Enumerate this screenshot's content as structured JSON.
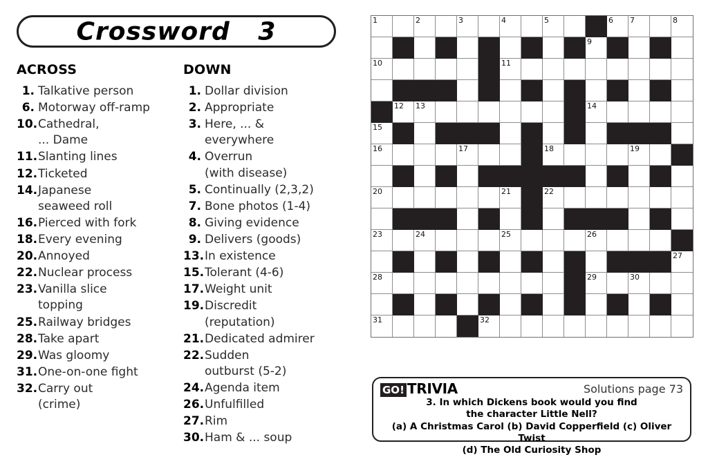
{
  "title": "Crossword   3",
  "across": {
    "heading": "ACROSS",
    "clues": [
      {
        "num": "1.",
        "text": "Talkative person"
      },
      {
        "num": "6.",
        "text": "Motorway off-ramp"
      },
      {
        "num": "10.",
        "text": "Cathedral,\n... Dame"
      },
      {
        "num": "11.",
        "text": "Slanting lines"
      },
      {
        "num": "12.",
        "text": "Ticketed"
      },
      {
        "num": "14.",
        "text": "Japanese\nseaweed roll"
      },
      {
        "num": "16.",
        "text": "Pierced with fork"
      },
      {
        "num": "18.",
        "text": "Every evening"
      },
      {
        "num": "20.",
        "text": "Annoyed"
      },
      {
        "num": "22.",
        "text": "Nuclear process"
      },
      {
        "num": "23.",
        "text": "Vanilla slice\ntopping"
      },
      {
        "num": "25.",
        "text": "Railway bridges"
      },
      {
        "num": "28.",
        "text": "Take apart"
      },
      {
        "num": "29.",
        "text": "Was gloomy"
      },
      {
        "num": "31.",
        "text": "One-on-one fight"
      },
      {
        "num": "32.",
        "text": "Carry out\n(crime)"
      }
    ]
  },
  "down": {
    "heading": "DOWN",
    "clues": [
      {
        "num": "1.",
        "text": "Dollar division"
      },
      {
        "num": "2.",
        "text": "Appropriate"
      },
      {
        "num": "3.",
        "text": "Here, ... &\neverywhere"
      },
      {
        "num": "4.",
        "text": "Overrun\n(with disease)"
      },
      {
        "num": "5.",
        "text": "Continually (2,3,2)"
      },
      {
        "num": "7.",
        "text": "Bone photos (1-4)"
      },
      {
        "num": "8.",
        "text": "Giving evidence"
      },
      {
        "num": "9.",
        "text": "Delivers (goods)"
      },
      {
        "num": "13.",
        "text": "In existence"
      },
      {
        "num": "15.",
        "text": "Tolerant (4-6)"
      },
      {
        "num": "17.",
        "text": "Weight unit"
      },
      {
        "num": "19.",
        "text": "Discredit\n(reputation)"
      },
      {
        "num": "21.",
        "text": "Dedicated admirer"
      },
      {
        "num": "22.",
        "text": "Sudden\noutburst (5-2)"
      },
      {
        "num": "24.",
        "text": "Agenda item"
      },
      {
        "num": "26.",
        "text": "Unfulfilled"
      },
      {
        "num": "27.",
        "text": "Rim"
      },
      {
        "num": "30.",
        "text": "Ham & ... soup"
      }
    ]
  },
  "grid": {
    "rows": 15,
    "cols": 15,
    "cell_size": 31,
    "black_cells": [
      [
        0,
        10
      ],
      [
        1,
        1
      ],
      [
        1,
        3
      ],
      [
        1,
        5
      ],
      [
        1,
        7
      ],
      [
        1,
        9
      ],
      [
        1,
        11
      ],
      [
        1,
        13
      ],
      [
        2,
        5
      ],
      [
        3,
        1
      ],
      [
        3,
        2
      ],
      [
        3,
        3
      ],
      [
        3,
        5
      ],
      [
        3,
        7
      ],
      [
        3,
        9
      ],
      [
        3,
        11
      ],
      [
        3,
        13
      ],
      [
        4,
        0
      ],
      [
        4,
        9
      ],
      [
        5,
        1
      ],
      [
        5,
        3
      ],
      [
        5,
        4
      ],
      [
        5,
        5
      ],
      [
        5,
        7
      ],
      [
        5,
        9
      ],
      [
        5,
        11
      ],
      [
        5,
        12
      ],
      [
        5,
        13
      ],
      [
        6,
        7
      ],
      [
        6,
        14
      ],
      [
        7,
        1
      ],
      [
        7,
        3
      ],
      [
        7,
        5
      ],
      [
        7,
        6
      ],
      [
        7,
        7
      ],
      [
        7,
        8
      ],
      [
        7,
        9
      ],
      [
        7,
        11
      ],
      [
        7,
        13
      ],
      [
        8,
        7
      ],
      [
        9,
        1
      ],
      [
        9,
        2
      ],
      [
        9,
        3
      ],
      [
        9,
        5
      ],
      [
        9,
        7
      ],
      [
        9,
        9
      ],
      [
        9,
        10
      ],
      [
        9,
        11
      ],
      [
        9,
        13
      ],
      [
        10,
        14
      ],
      [
        11,
        1
      ],
      [
        11,
        3
      ],
      [
        11,
        5
      ],
      [
        11,
        7
      ],
      [
        11,
        9
      ],
      [
        11,
        11
      ],
      [
        11,
        12
      ],
      [
        11,
        13
      ],
      [
        12,
        9
      ],
      [
        13,
        1
      ],
      [
        13,
        3
      ],
      [
        13,
        5
      ],
      [
        13,
        7
      ],
      [
        13,
        9
      ],
      [
        13,
        11
      ],
      [
        13,
        13
      ],
      [
        14,
        4
      ]
    ],
    "numbers": [
      {
        "row": 0,
        "col": 0,
        "n": "1"
      },
      {
        "row": 0,
        "col": 2,
        "n": "2"
      },
      {
        "row": 0,
        "col": 4,
        "n": "3"
      },
      {
        "row": 0,
        "col": 6,
        "n": "4"
      },
      {
        "row": 0,
        "col": 8,
        "n": "5"
      },
      {
        "row": 0,
        "col": 11,
        "n": "6"
      },
      {
        "row": 0,
        "col": 12,
        "n": "7"
      },
      {
        "row": 0,
        "col": 14,
        "n": "8"
      },
      {
        "row": 1,
        "col": 10,
        "n": "9"
      },
      {
        "row": 2,
        "col": 0,
        "n": "10"
      },
      {
        "row": 2,
        "col": 6,
        "n": "11"
      },
      {
        "row": 4,
        "col": 1,
        "n": "12"
      },
      {
        "row": 4,
        "col": 2,
        "n": "13"
      },
      {
        "row": 4,
        "col": 10,
        "n": "14"
      },
      {
        "row": 5,
        "col": 0,
        "n": "15"
      },
      {
        "row": 6,
        "col": 0,
        "n": "16"
      },
      {
        "row": 6,
        "col": 4,
        "n": "17"
      },
      {
        "row": 6,
        "col": 8,
        "n": "18"
      },
      {
        "row": 6,
        "col": 12,
        "n": "19"
      },
      {
        "row": 8,
        "col": 0,
        "n": "20"
      },
      {
        "row": 8,
        "col": 6,
        "n": "21"
      },
      {
        "row": 8,
        "col": 8,
        "n": "22"
      },
      {
        "row": 10,
        "col": 0,
        "n": "23"
      },
      {
        "row": 10,
        "col": 2,
        "n": "24"
      },
      {
        "row": 10,
        "col": 6,
        "n": "25"
      },
      {
        "row": 10,
        "col": 10,
        "n": "26"
      },
      {
        "row": 11,
        "col": 14,
        "n": "27"
      },
      {
        "row": 12,
        "col": 0,
        "n": "28"
      },
      {
        "row": 12,
        "col": 10,
        "n": "29"
      },
      {
        "row": 12,
        "col": 12,
        "n": "30"
      },
      {
        "row": 14,
        "col": 0,
        "n": "31"
      },
      {
        "row": 14,
        "col": 5,
        "n": "32"
      }
    ]
  },
  "trivia": {
    "logo_badge": "GO!",
    "logo_word": "TRIVIA",
    "solutions": "Solutions page 73",
    "question": "3. In which Dickens book would you find\nthe character Little Nell?",
    "answers": "(a) A Christmas Carol (b) David Copperfield (c) Oliver Twist\n(d) The Old Curiosity Shop"
  }
}
